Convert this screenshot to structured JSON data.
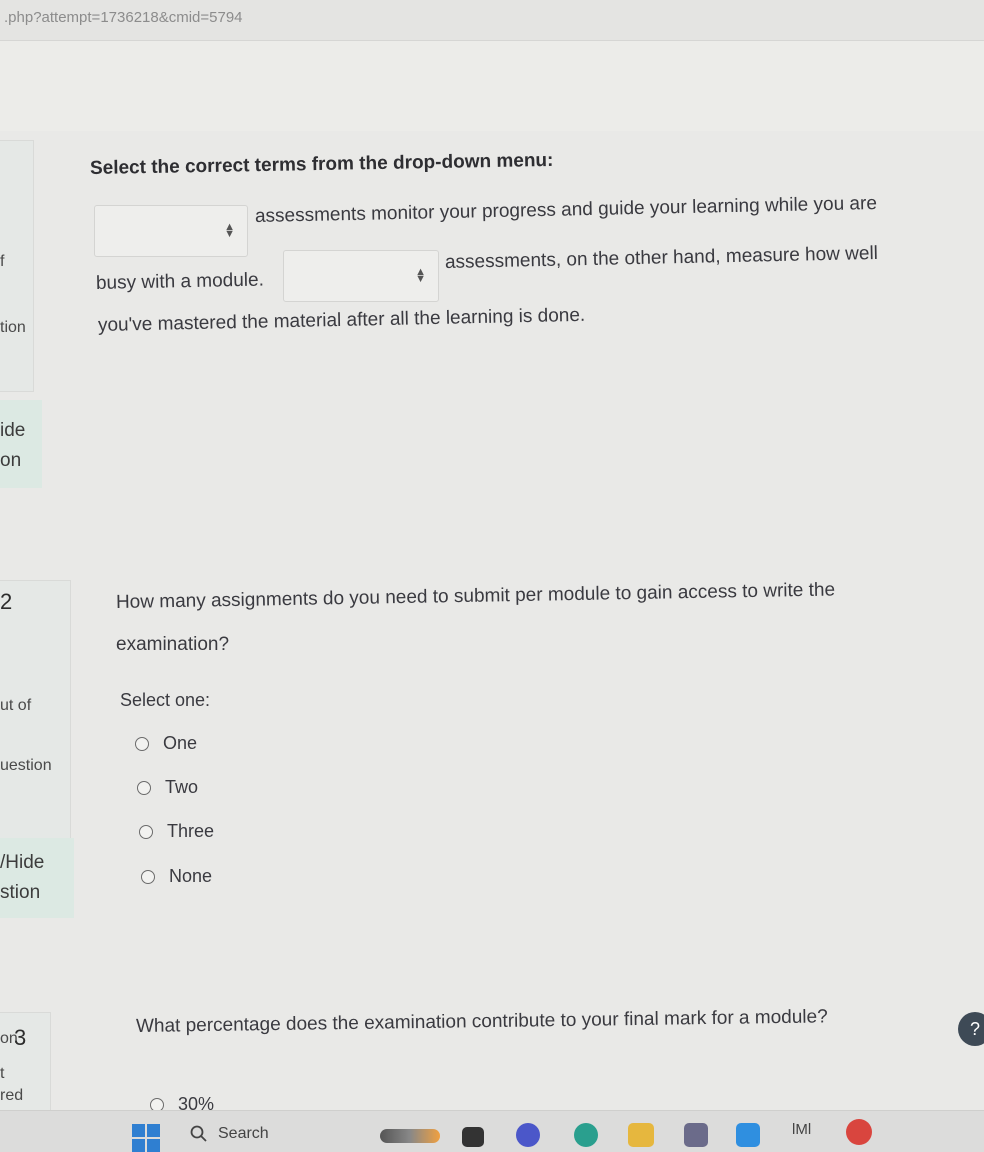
{
  "browser": {
    "url": ".php?attempt=1736218&cmid=5794"
  },
  "sidebar": {
    "frag_f": "f",
    "frag_tion": "tion",
    "frag_ide": "ide",
    "frag_on": "on",
    "q2_number": "2",
    "frag_out_of": "ut of",
    "frag_question": "uestion",
    "frag_hide": "/Hide",
    "frag_stion": "stion",
    "frag_on3": "on",
    "q3_number": "3",
    "frag_t": "t",
    "frag_red": "red"
  },
  "question1": {
    "title": "Select the correct terms from the drop-down menu:",
    "dropdown1_value": "",
    "line1": "assessments monitor your progress and guide your learning while you are",
    "line2_start": "busy with a module.",
    "dropdown2_value": "",
    "line2_end": "assessments, on the other hand, measure how well",
    "line3": "you've mastered the material after all the learning is done."
  },
  "question2": {
    "text_line1": "How many assignments do you need to submit per module to gain access to write the",
    "text_line2": "examination?",
    "select_label": "Select one:",
    "options": [
      "One",
      "Two",
      "Three",
      "None"
    ]
  },
  "question3": {
    "text": "What percentage does the examination contribute to your final mark for a module?",
    "options": [
      "30%"
    ]
  },
  "taskbar": {
    "search_label": "Search",
    "app_label": "lMl"
  },
  "help": {
    "label": "?"
  },
  "colors": {
    "page_bg": "#e9e9e7",
    "mint_panel": "#dce9e3",
    "windows_blue": "#2f7fd1"
  }
}
